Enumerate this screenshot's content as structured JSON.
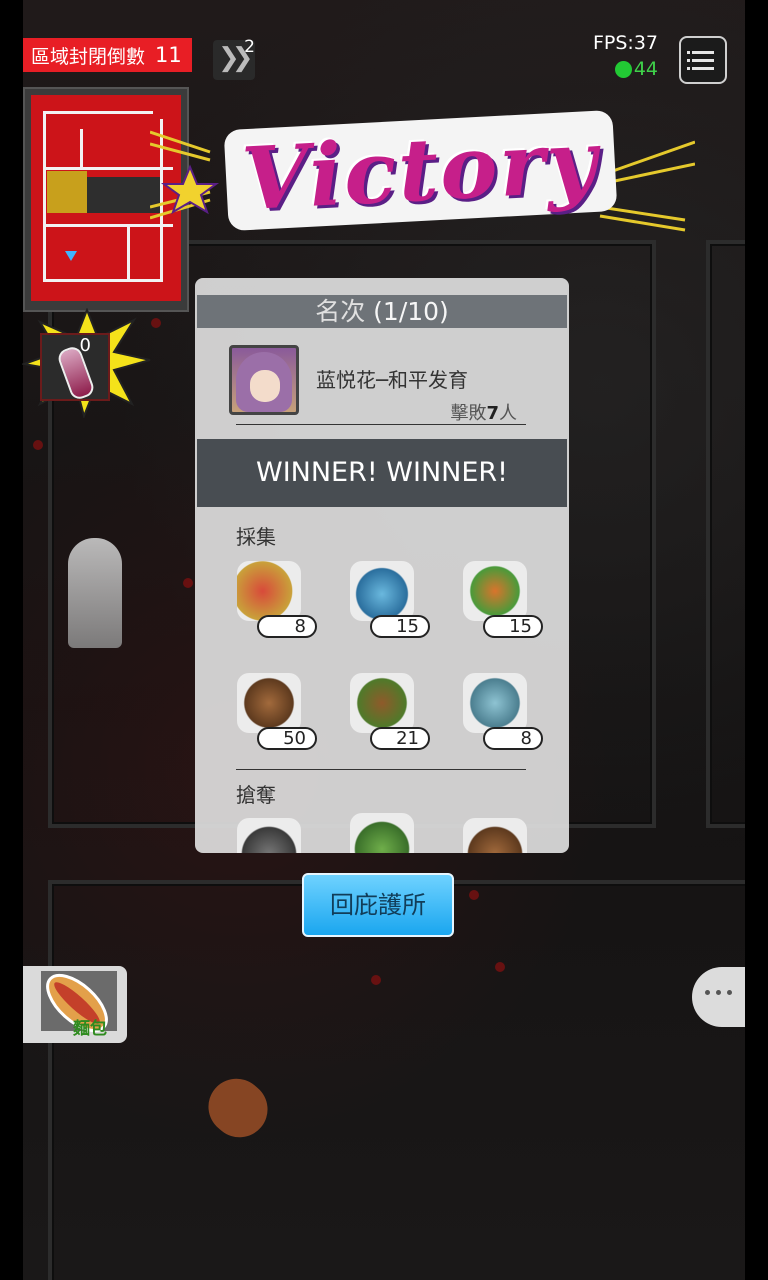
{
  "hud": {
    "zone_close_label": "區域封閉倒數",
    "zone_close_count": "11",
    "speed_badge": "2",
    "fps": "FPS:37",
    "ping": "44"
  },
  "item_slot": {
    "count": "0"
  },
  "victory": {
    "title": "Victory"
  },
  "results": {
    "rank_label": "名次",
    "rank_value": "(1/10)",
    "player_name": "蓝悦花─和平发育",
    "kills_prefix": "擊敗",
    "kills_count": "7",
    "kills_suffix": "人",
    "winner_text": "WINNER! WINNER!",
    "gather_title": "採集",
    "gather_items": [
      {
        "name": "fruit-basket-icon",
        "count": "8",
        "color": "#c9a13a"
      },
      {
        "name": "water-bottle-icon",
        "count": "15",
        "color": "#6ab8de"
      },
      {
        "name": "vegetables-meat-icon",
        "count": "15",
        "color": "#d9742c"
      },
      {
        "name": "wood-log-icon",
        "count": "50",
        "color": "#8a5a32"
      },
      {
        "name": "seeds-icon",
        "count": "21",
        "color": "#8f5a2a"
      },
      {
        "name": "pipe-icon",
        "count": "8",
        "color": "#6a9fb0"
      }
    ],
    "loot_title": "搶奪"
  },
  "buttons": {
    "return_shelter": "回庇護所",
    "bread_label": "麵包"
  },
  "colors": {
    "countdown_bg": "#e81e25",
    "ping_green": "#22c934",
    "return_button": "#1aa6ef",
    "winner_bar": "#484d52"
  }
}
